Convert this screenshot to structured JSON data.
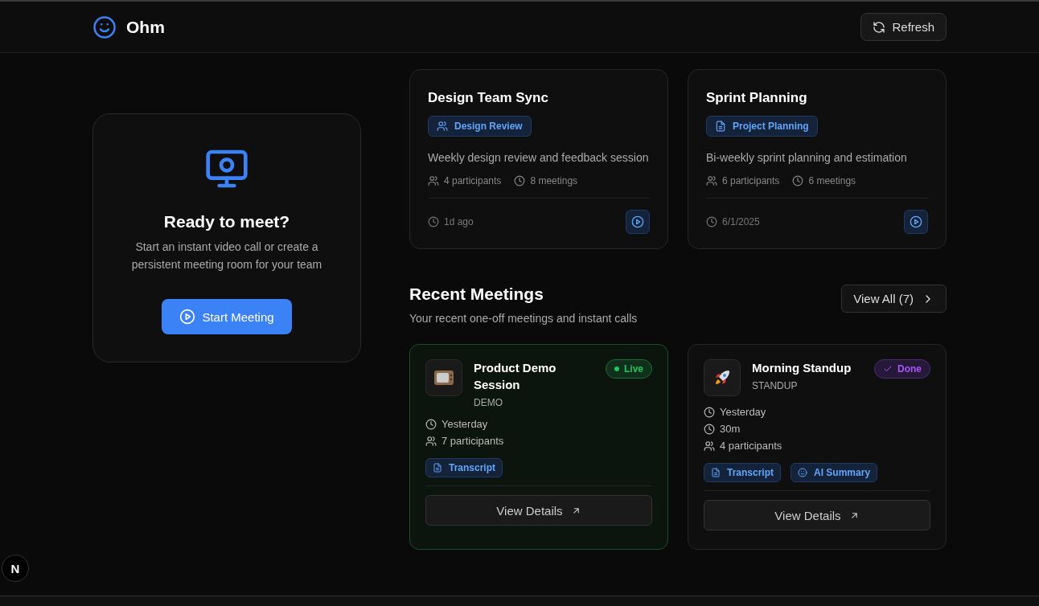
{
  "header": {
    "brand": "Ohm",
    "refresh_button": "Refresh"
  },
  "hero": {
    "title": "Ready to meet?",
    "description": "Start an instant video call or create a persistent meeting room for your team",
    "start_button": "Start Meeting"
  },
  "rooms": [
    {
      "title": "Design Team Sync",
      "tag": {
        "label": "Design Review",
        "kind": "people"
      },
      "description": "Weekly design review and feedback session",
      "participants": "4 participants",
      "meetings": "8 meetings",
      "last": "1d ago"
    },
    {
      "title": "Sprint Planning",
      "tag": {
        "label": "Project Planning",
        "kind": "document"
      },
      "description": "Bi-weekly sprint planning and estimation",
      "participants": "6 participants",
      "meetings": "6 meetings",
      "last": "6/1/2025"
    }
  ],
  "recent": {
    "title": "Recent Meetings",
    "subtitle": "Your recent one-off meetings and instant calls",
    "view_all": "View All (7)"
  },
  "meetings": [
    {
      "kind": "tv",
      "title": "Product Demo Session",
      "type": "DEMO",
      "status": {
        "label": "Live",
        "kind": "live"
      },
      "details": [
        {
          "kind": "time",
          "text": "Yesterday"
        },
        {
          "kind": "participants",
          "text": "7 participants"
        }
      ],
      "tags": [
        {
          "kind": "transcript",
          "label": "Transcript"
        }
      ],
      "button": "View Details"
    },
    {
      "kind": "rocket",
      "title": "Morning Standup",
      "type": "STANDUP",
      "status": {
        "label": "Done",
        "kind": "done"
      },
      "details": [
        {
          "kind": "time",
          "text": "Yesterday"
        },
        {
          "kind": "time",
          "text": "30m"
        },
        {
          "kind": "participants",
          "text": "4 participants"
        }
      ],
      "tags": [
        {
          "kind": "transcript",
          "label": "Transcript"
        },
        {
          "kind": "summary",
          "label": "AI Summary"
        }
      ],
      "button": "View Details"
    }
  ],
  "dev_badge": "N"
}
